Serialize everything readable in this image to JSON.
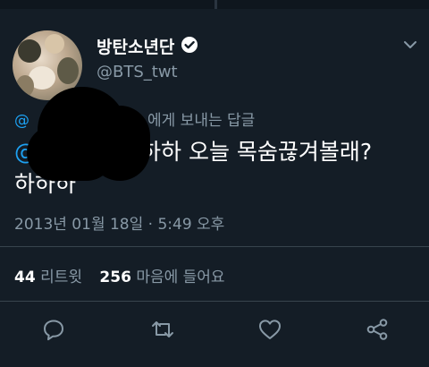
{
  "tweet": {
    "author": {
      "display_name": "방탄소년단",
      "handle": "@BTS_twt",
      "verified": true
    },
    "reply_context": {
      "mention": "@",
      "rest": "에게 보내는 답글"
    },
    "text": {
      "mention": "@",
      "line1": "하하 오늘 목숨끊겨볼래?",
      "line2": "하하하"
    },
    "timestamp": "2013년 01월 18일 · 5:49 오후",
    "stats": {
      "retweets": "44",
      "retweets_label": "리트윗",
      "likes": "256",
      "likes_label": "마음에 들어요"
    }
  },
  "icons": {
    "menu": "chevron-down-icon",
    "reply": "reply-icon",
    "retweet": "retweet-icon",
    "like": "heart-icon",
    "share": "share-icon",
    "verified": "verified-badge-icon"
  },
  "colors": {
    "background": "#141d26",
    "text": "#ffffff",
    "secondary": "#8899a6",
    "accent": "#1da1f2",
    "divider": "#38444d"
  }
}
